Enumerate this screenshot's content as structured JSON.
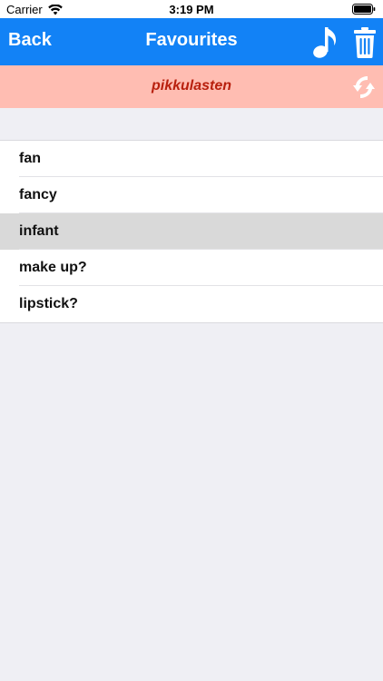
{
  "status_bar": {
    "carrier": "Carrier",
    "time": "3:19 PM"
  },
  "navbar": {
    "back_label": "Back",
    "title": "Favourites",
    "background": "#1282F6",
    "icons": [
      "music-note-icon",
      "trash-icon"
    ]
  },
  "banner": {
    "text": "pikkulasten",
    "background": "#FFBDB2",
    "text_color": "#B8200E",
    "icon": "swap-icon"
  },
  "favourites": {
    "selected_index": 2,
    "items": [
      {
        "label": "fan"
      },
      {
        "label": "fancy"
      },
      {
        "label": "infant"
      },
      {
        "label": "make up?"
      },
      {
        "label": "lipstick?"
      }
    ]
  }
}
